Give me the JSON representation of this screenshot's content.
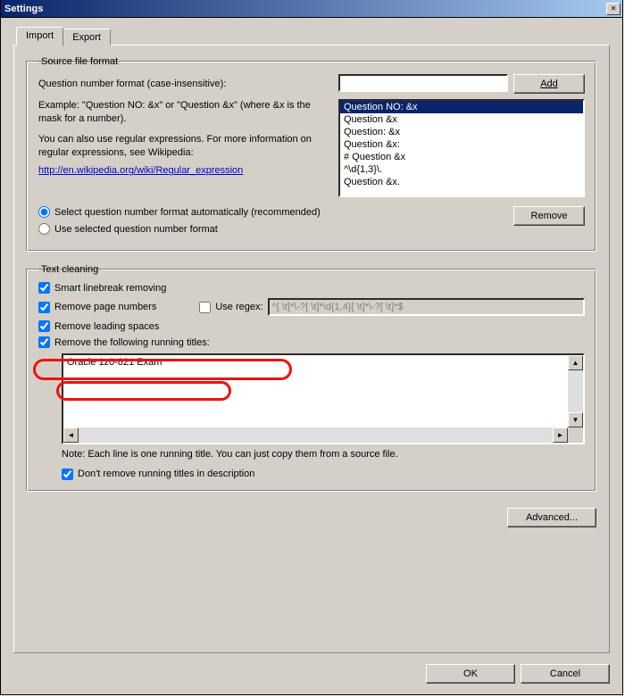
{
  "title": "Settings",
  "tabs": {
    "import": "Import",
    "export": "Export"
  },
  "source": {
    "legend": "Source file format",
    "qnum_label": "Question number format (case-insensitive):",
    "add": "Add",
    "example": "Example: \"Question NO: &x\" or \"Question &x\" (where &x is the mask for a number).",
    "regex_info": "You can also use regular expressions. For more information on regular expressions, see Wikipedia:",
    "link": "http://en.wikipedia.org/wiki/Regular_expression",
    "formats": [
      "Question NO: &x",
      "Question &x",
      "Question: &x",
      "Question &x:",
      "# Question &x",
      "^\\d{1,3}\\.",
      "Question &x."
    ],
    "radio_auto": "Select question number format automatically (recommended)",
    "radio_sel": "Use selected question number format",
    "remove": "Remove"
  },
  "clean": {
    "legend": "Text cleaning",
    "smart_lb": "Smart linebreak removing",
    "remove_pages": "Remove page numbers",
    "use_regex": "Use regex:",
    "regex_placeholder": "^[ \\t]*\\-?[ \\t]*\\d{1,4}[ \\t]*\\-?[ \\t]*$",
    "remove_leading": "Remove leading spaces",
    "remove_titles": "Remove the following running titles:",
    "titles_value": "Oracle 1z0-821 Exam",
    "note": "Note: Each line is one running title. You can just copy them from a source file.",
    "dont_remove_desc": "Don't remove running titles in description"
  },
  "buttons": {
    "advanced": "Advanced...",
    "ok": "OK",
    "cancel": "Cancel"
  }
}
